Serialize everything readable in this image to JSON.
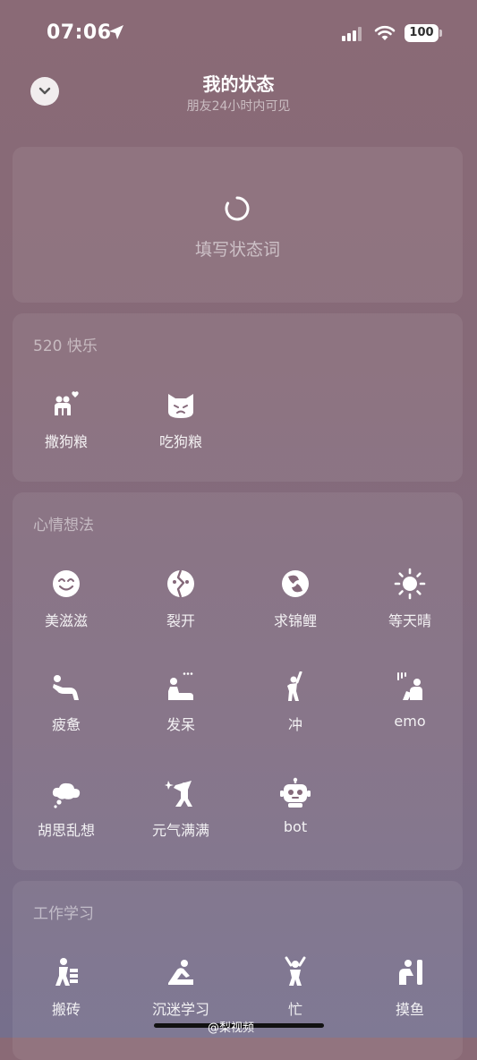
{
  "status_bar": {
    "time": "07:06",
    "battery": "100"
  },
  "header": {
    "title": "我的状态",
    "subtitle": "朋友24小时内可见"
  },
  "input_card": {
    "label": "填写状态词"
  },
  "sections": [
    {
      "title": "520 快乐",
      "items": [
        {
          "label": "撒狗粮",
          "icon": "couple-love-icon"
        },
        {
          "label": "吃狗粮",
          "icon": "grumpy-cat-icon"
        }
      ]
    },
    {
      "title": "心情想法",
      "items": [
        {
          "label": "美滋滋",
          "icon": "smile-face-icon"
        },
        {
          "label": "裂开",
          "icon": "cracked-face-icon"
        },
        {
          "label": "求锦鲤",
          "icon": "koi-fish-icon"
        },
        {
          "label": "等天晴",
          "icon": "sun-icon"
        },
        {
          "label": "疲惫",
          "icon": "tired-person-icon"
        },
        {
          "label": "发呆",
          "icon": "daze-person-icon"
        },
        {
          "label": "冲",
          "icon": "rush-person-icon"
        },
        {
          "label": "emo",
          "icon": "emo-person-icon"
        },
        {
          "label": "胡思乱想",
          "icon": "thought-cloud-icon"
        },
        {
          "label": "元气满满",
          "icon": "energetic-person-icon"
        },
        {
          "label": "bot",
          "icon": "robot-icon"
        }
      ]
    },
    {
      "title": "工作学习",
      "items": [
        {
          "label": "搬砖",
          "icon": "brick-carrier-icon"
        },
        {
          "label": "沉迷学习",
          "icon": "studying-person-icon"
        },
        {
          "label": "忙",
          "icon": "busy-person-icon"
        },
        {
          "label": "摸鱼",
          "icon": "slacking-person-icon"
        }
      ]
    }
  ],
  "watermark": "@梨视频"
}
